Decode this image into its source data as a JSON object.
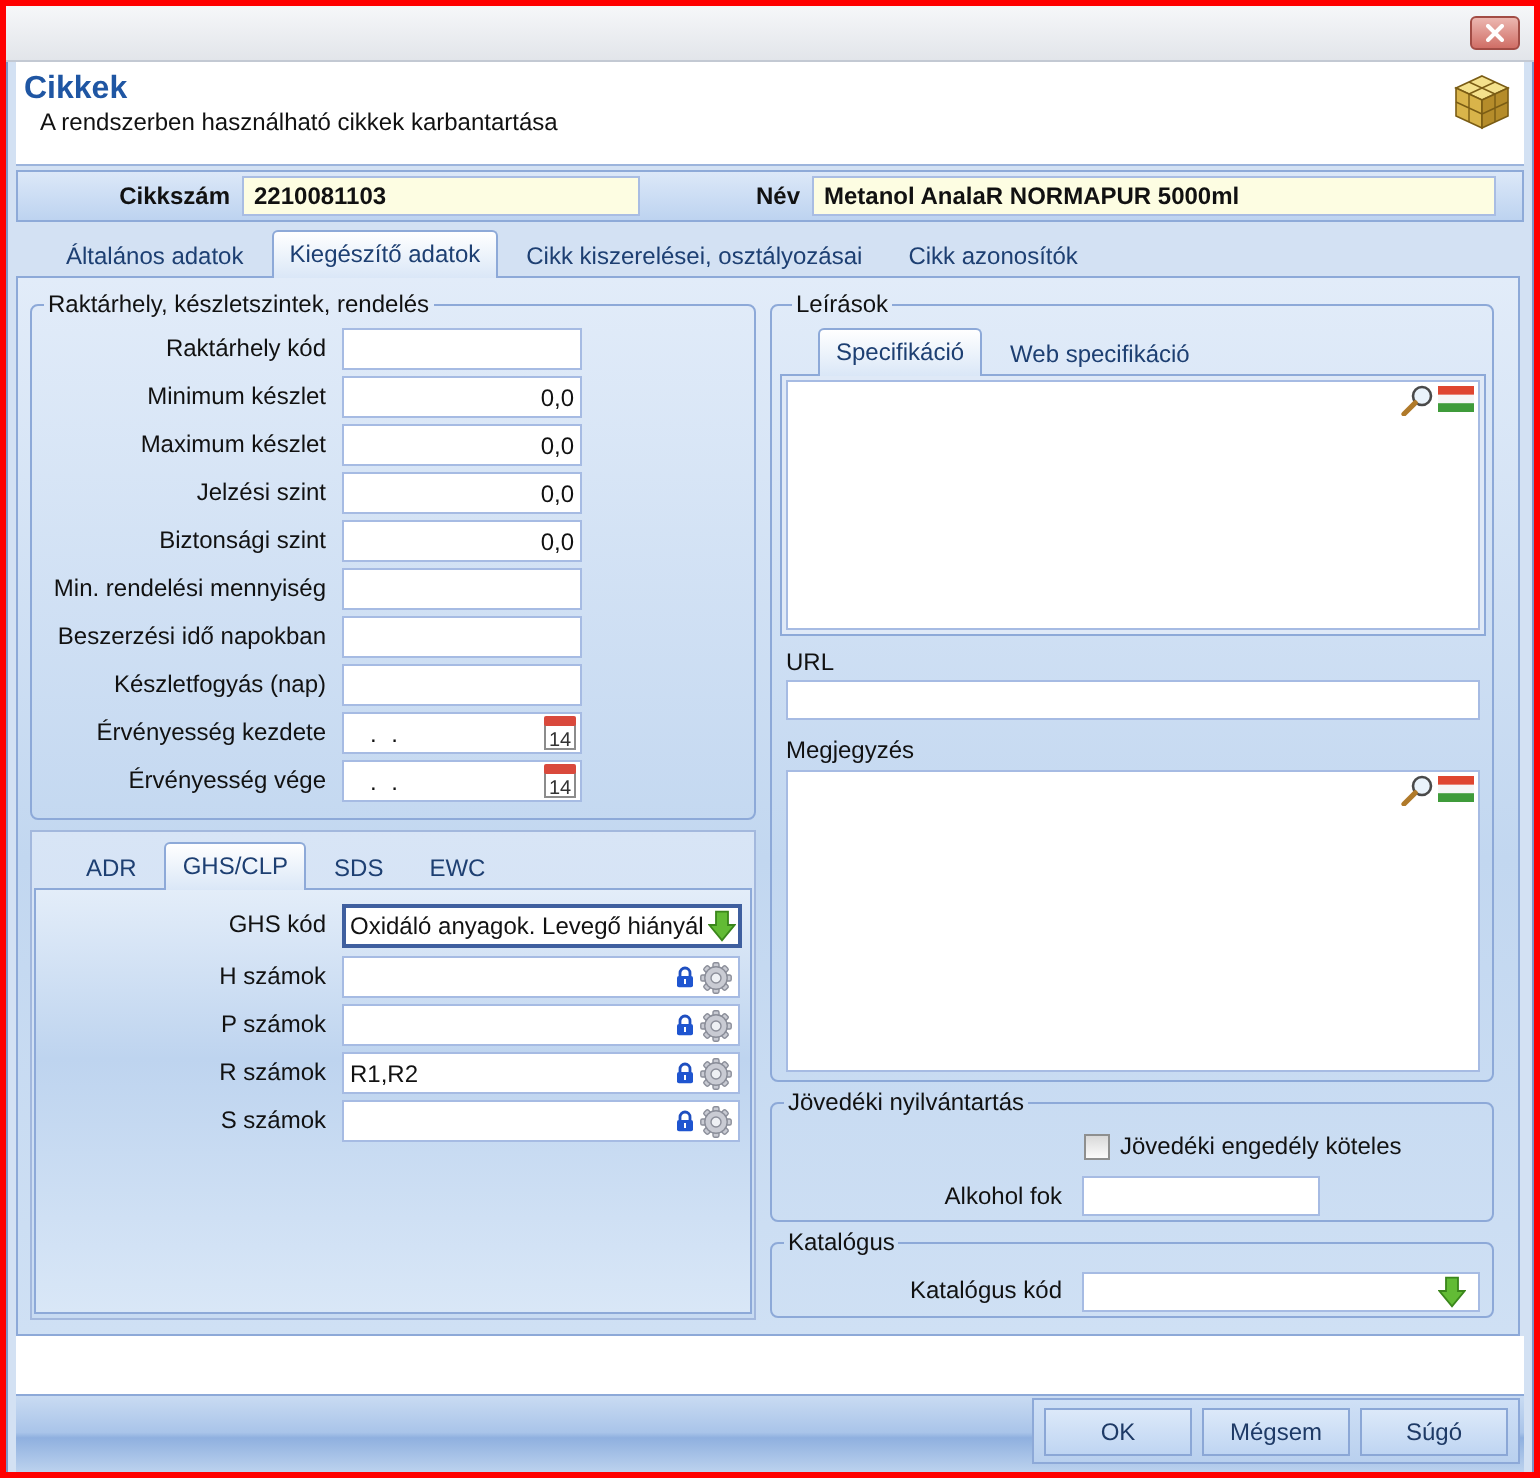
{
  "header": {
    "title": "Cikkek",
    "subtitle": "A rendszerben használható cikkek karbantartása"
  },
  "item": [
    {
      "label": "Cikkszám",
      "value": "2210081103"
    },
    {
      "label": "Név",
      "value": "Metanol AnalaR NORMAPUR 5000ml"
    }
  ],
  "tabs": [
    {
      "label": "Általános adatok",
      "selected": false
    },
    {
      "label": "Kiegészítő adatok",
      "selected": true
    },
    {
      "label": "Cikk kiszerelései, osztályozásai",
      "selected": false
    },
    {
      "label": "Cikk azonosítók",
      "selected": false
    }
  ],
  "stock": {
    "title": "Raktárhely, készletszintek, rendelés",
    "fields": [
      {
        "kind": "text",
        "label": "Raktárhely kód"
      },
      {
        "kind": "number",
        "label": "Minimum készlet",
        "value": "0,0"
      },
      {
        "kind": "number",
        "label": "Maximum készlet",
        "value": "0,0"
      },
      {
        "kind": "number",
        "label": "Jelzési szint",
        "value": "0,0"
      },
      {
        "kind": "number",
        "label": "Biztonsági szint",
        "value": "0,0"
      },
      {
        "kind": "text",
        "label": "Min. rendelési mennyiség"
      },
      {
        "kind": "text",
        "label": "Beszerzési idő napokban"
      },
      {
        "kind": "text",
        "label": "Készletfogyás (nap)"
      },
      {
        "kind": "date",
        "label": "Érvényesség kezdete",
        "value": ". .",
        "calendar_day": "14"
      },
      {
        "kind": "date",
        "label": "Érvényesség vége",
        "value": ". .",
        "calendar_day": "14"
      }
    ]
  },
  "hazard": {
    "tabs": [
      {
        "label": "ADR",
        "selected": false
      },
      {
        "label": "GHS/CLP",
        "selected": true
      },
      {
        "label": "SDS",
        "selected": false
      },
      {
        "label": "EWC",
        "selected": false
      }
    ],
    "fields": [
      {
        "kind": "dropdown",
        "label": "GHS kód",
        "value": "Oxidáló anyagok. Levegő hiányál",
        "focused": true
      },
      {
        "kind": "coded",
        "label": "H számok",
        "focused": false
      },
      {
        "kind": "coded",
        "label": "P számok",
        "focused": false
      },
      {
        "kind": "coded",
        "label": "R számok",
        "value": "R1,R2",
        "focused": false
      },
      {
        "kind": "coded",
        "label": "S számok",
        "focused": false
      }
    ]
  },
  "descriptions": {
    "title": "Leírások",
    "tabs": [
      {
        "label": "Specifikáció",
        "selected": true
      },
      {
        "label": "Web specifikáció",
        "selected": false
      }
    ],
    "url_label": "URL",
    "note_label": "Megjegyzés"
  },
  "excise": {
    "title": "Jövedéki nyilvántartás",
    "checkbox": {
      "label": "Jövedéki engedély köteles",
      "checked": false
    },
    "alcohol_label": "Alkohol fok"
  },
  "catalog": {
    "title": "Katalógus",
    "code_label": "Katalógus kód"
  },
  "buttons": [
    "OK",
    "Mégsem",
    "Súgó"
  ]
}
